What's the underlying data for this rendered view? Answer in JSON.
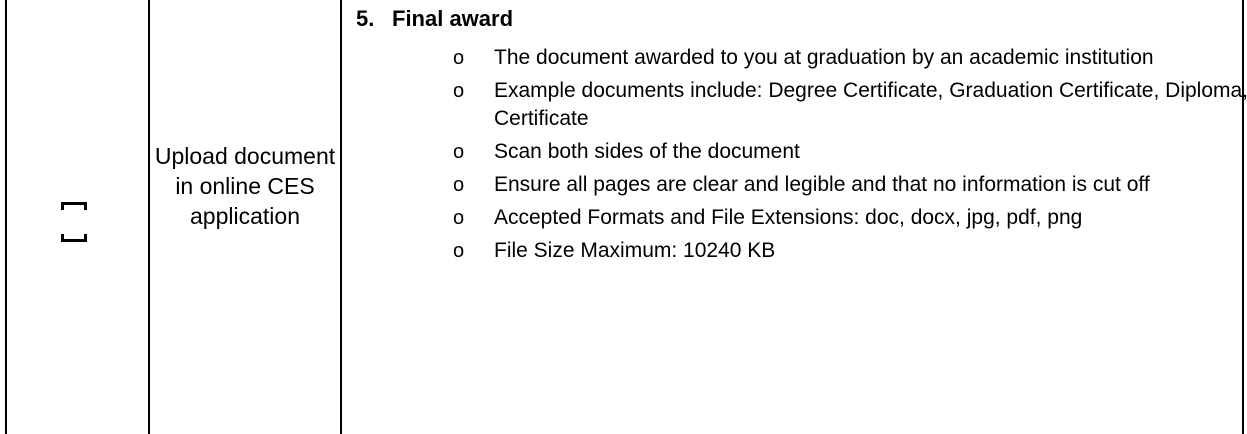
{
  "row": {
    "checkbox": {
      "icon": "checkbox-empty-icon"
    },
    "action": {
      "text": "Upload document in online CES application"
    },
    "section": {
      "number": "5.",
      "title": "Final award",
      "bullet_marker": "o",
      "bullets": [
        "The document awarded to you at graduation by an academic institution",
        "Example documents include: Degree Certificate, Graduation Certificate, Diploma, or Certificate",
        "Scan both sides of the document",
        "Ensure all pages are clear and legible and that no information is cut off",
        "Accepted Formats and File Extensions: doc, docx, jpg, pdf, png",
        "File Size Maximum: 10240 KB"
      ]
    }
  }
}
